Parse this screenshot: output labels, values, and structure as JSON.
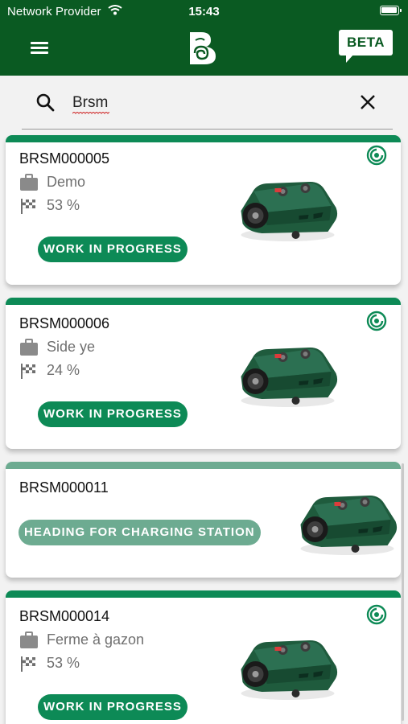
{
  "status_bar": {
    "carrier": "Network Provider",
    "time": "15:43"
  },
  "header": {
    "beta_label": "BETA",
    "logo_icon": "bee-swirl-logo-icon",
    "menu_icon": "hamburger-menu-icon"
  },
  "search": {
    "query": "Brsm",
    "search_icon": "search-icon",
    "clear_icon": "close-icon"
  },
  "colors": {
    "header_green": "#0a5a22",
    "work_green": "#0d8a56",
    "charging_green": "#6dab91",
    "card_bg": "#ffffff",
    "page_bg": "#f2f2f2"
  },
  "robots": [
    {
      "id": "BRSM000005",
      "site": "Demo",
      "progress": "53 %",
      "status": "WORK IN PROGRESS"
    },
    {
      "id": "BRSM000006",
      "site": "Side ye",
      "progress": "24 %",
      "status": "WORK IN PROGRESS"
    },
    {
      "id": "BRSM000011",
      "status": "HEADING FOR CHARGING STATION"
    },
    {
      "id": "BRSM000014",
      "site": "Ferme à gazon",
      "progress": "53 %",
      "status": "WORK IN PROGRESS"
    }
  ]
}
